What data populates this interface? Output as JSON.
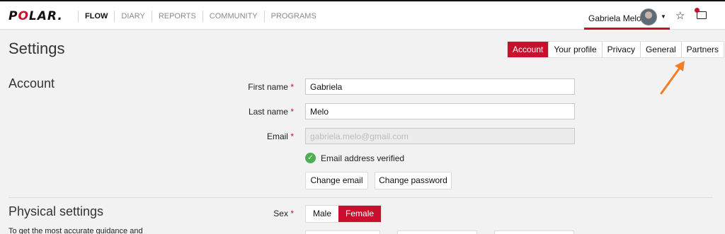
{
  "brand": {
    "logo": "POLAR."
  },
  "nav": [
    "FLOW",
    "DIARY",
    "REPORTS",
    "COMMUNITY",
    "PROGRAMS"
  ],
  "user": {
    "name": "Gabriela Melo"
  },
  "icons": {
    "avatar": "user-avatar",
    "caret": "caret-down-icon",
    "favorites": "star-icon",
    "notifications": "notification-icon"
  },
  "colors": {
    "accent": "#c8102e",
    "verified": "#4caf50",
    "arrow": "#f07f2a"
  },
  "page": {
    "title": "Settings"
  },
  "tabs": [
    "Account",
    "Your profile",
    "Privacy",
    "General",
    "Partners"
  ],
  "account": {
    "title": "Account",
    "first_name_label": "First name",
    "first_name_value": "Gabriela",
    "last_name_label": "Last name",
    "last_name_value": "Melo",
    "email_label": "Email",
    "email_value": "gabriela.melo@gmail.com",
    "verified_text": "Email address verified",
    "change_email": "Change email",
    "change_password": "Change password"
  },
  "physical": {
    "title": "Physical settings",
    "sex_label": "Sex",
    "sex_options": [
      "Male",
      "Female"
    ],
    "sex_selected": "Female",
    "help_text": "To get the most accurate guidance and"
  },
  "required_mark": "*"
}
